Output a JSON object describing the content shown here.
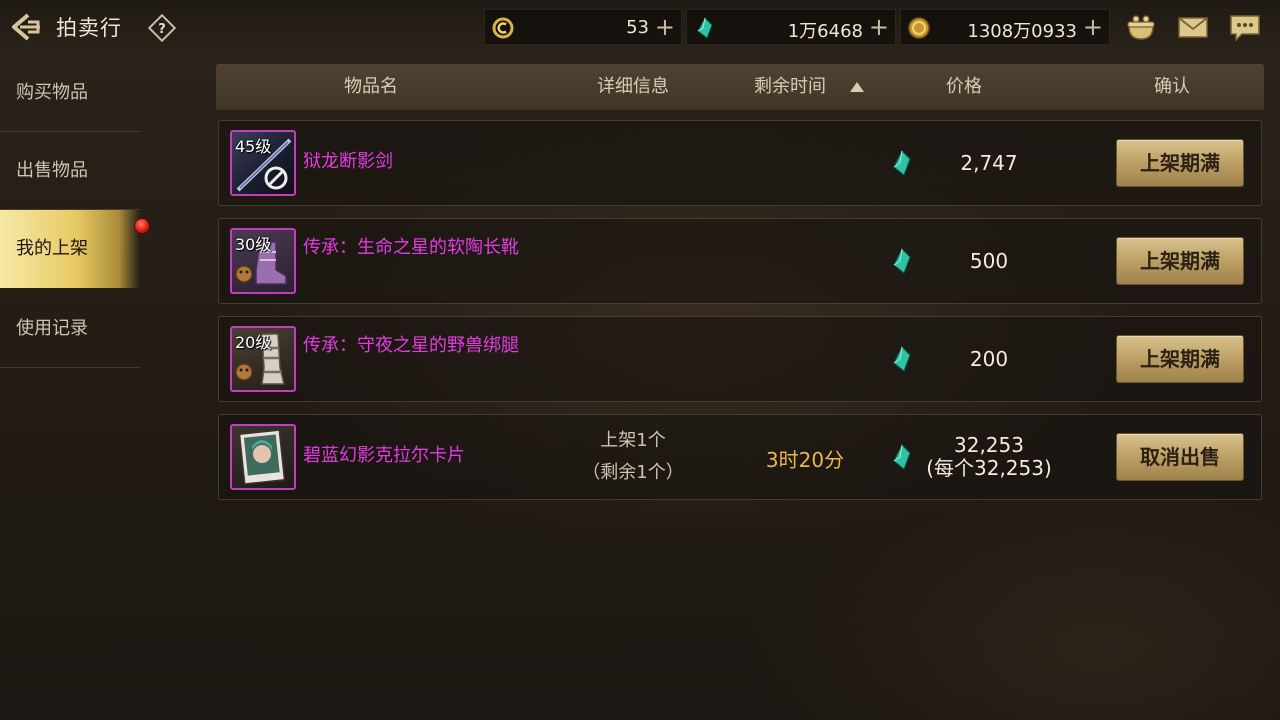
{
  "header": {
    "title": "拍卖行",
    "currencies": [
      {
        "icon": "c-coin-icon",
        "value": "53"
      },
      {
        "icon": "teal-gem-icon",
        "value": "1万6468"
      },
      {
        "icon": "gold-coin-icon",
        "value": "1308万0933"
      }
    ],
    "plus_symbol": "+"
  },
  "sidebar": {
    "items": [
      {
        "label": "购买物品"
      },
      {
        "label": "出售物品"
      },
      {
        "label": "我的上架"
      },
      {
        "label": "使用记录"
      }
    ],
    "active_index": 2
  },
  "table": {
    "headers": [
      "物品名",
      "详细信息",
      "剩余时间",
      "价格",
      "确认"
    ],
    "rows": [
      {
        "level": "45级",
        "name": "狱龙断影剑",
        "detail_line1": "",
        "detail_line2": "",
        "time_left": "",
        "price": "2,747",
        "price_each": "",
        "action": "上架期满"
      },
      {
        "level": "30级",
        "name": "传承：生命之星的软陶长靴",
        "detail_line1": "",
        "detail_line2": "",
        "time_left": "",
        "price": "500",
        "price_each": "",
        "action": "上架期满"
      },
      {
        "level": "20级",
        "name": "传承：守夜之星的野兽绑腿",
        "detail_line1": "",
        "detail_line2": "",
        "time_left": "",
        "price": "200",
        "price_each": "",
        "action": "上架期满"
      },
      {
        "level": "",
        "name": "碧蓝幻影克拉尔卡片",
        "detail_line1": "上架1个",
        "detail_line2": "（剩余1个）",
        "time_left": "3时20分",
        "price": "32,253",
        "price_each": "(每个32,253)",
        "action": "取消出售"
      }
    ]
  },
  "colors": {
    "item_name": "#e23ce0",
    "time_left": "#e9b74a",
    "button_gold": "#c9ae72",
    "active_tab": "#e7c964",
    "notify_dot": "#d8170c"
  }
}
